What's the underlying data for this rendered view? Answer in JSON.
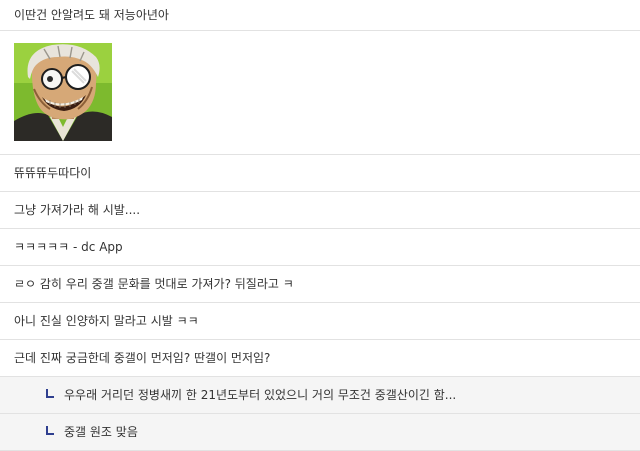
{
  "comments": [
    {
      "text": "이딴건 안알려도 돼 저능아년아"
    },
    {
      "image": "grinning-man-with-glasses-image"
    },
    {
      "text": "뜌뜌뜌두따다이"
    },
    {
      "text": "그냥 가져가라 해 시발...."
    },
    {
      "text": "ㅋㅋㅋㅋㅋ - dc App"
    },
    {
      "text": "ㄹㅇ 감히 우리 중갤 문화를 멋대로 가져가? 뒤질라고 ㅋ"
    },
    {
      "text": "아니 진실 인양하지 말라고 시발 ㅋㅋ"
    },
    {
      "text": "근데 진짜 궁금한데 중갤이 먼저임? 딴갤이 먼저임?"
    }
  ],
  "replies": [
    {
      "text": "우우래 거리던 정병새끼 한 21년도부터 있었으니 거의 무조건 중갤산이긴 함..."
    },
    {
      "text": "중갤 원조 맞음"
    }
  ],
  "colors": {
    "reply_marker": "#2f3f8f",
    "reply_background": "#f5f5f5",
    "divider": "#e2e2e2",
    "text": "#333333"
  }
}
